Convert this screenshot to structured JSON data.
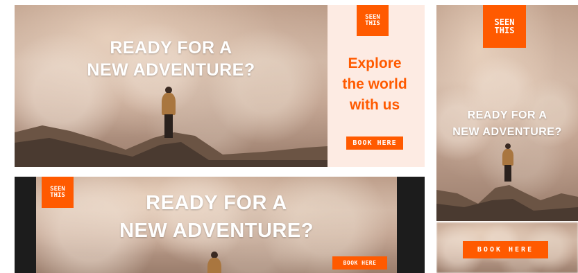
{
  "brand": {
    "logo_line1": "SEEN",
    "logo_line2": "THIS",
    "accent": "#ff5a00",
    "panel_bg": "#fdebe3",
    "dark_bg": "#1c1c1c"
  },
  "headline": {
    "line1": "READY FOR A",
    "line2": "NEW ADVENTURE?"
  },
  "tagline": {
    "line1": "Explore",
    "line2": "the world",
    "line3": "with us"
  },
  "cta": {
    "label": "BOOK HERE"
  }
}
